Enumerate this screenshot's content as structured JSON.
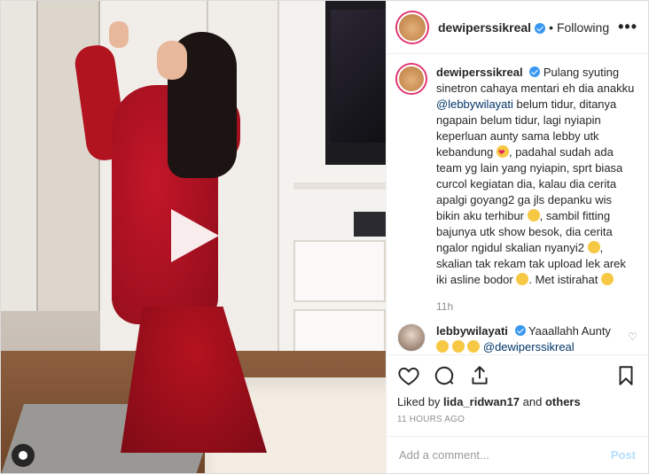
{
  "header": {
    "username": "dewiperssikreal",
    "separator": "•",
    "follow_status": "Following",
    "more_label": "•••"
  },
  "caption": {
    "username": "dewiperssikreal",
    "text_1": "Pulang syuting sinetron cahaya mentari eh dia anakku",
    "mention": "@lebbywilayati",
    "text_2": "belum tidur, ditanya ngapain belum tidur, lagi nyiapin keperluan aunty sama lebby utk kebandung",
    "text_3": ", padahal sudah ada team yg lain yang nyiapin, sprt biasa curcol kegiatan dia, kalau dia cerita apalgi goyang2 ga jls depanku wis bikin aku terhibur",
    "text_4": ", sambil fitting bajunya utk show besok, dia cerita ngalor ngidul skalian nyanyi2",
    "text_5": ", skalian tak rekam tak upload lek arek iki asline bodor",
    "text_6": ". Met istirahat",
    "time": "11h"
  },
  "reply": {
    "username": "lebbywilayati",
    "text": "Yaaallahh Aunty",
    "mention": "@dewiperssikreal"
  },
  "likes": {
    "prefix": "Liked by",
    "user": "lida_ridwan17",
    "conj": "and",
    "others": "others"
  },
  "timestamp": "11 HOURS AGO",
  "comment_box": {
    "placeholder": "Add a comment...",
    "post_label": "Post"
  },
  "colors": {
    "verified": "#3897f0",
    "post_disabled": "#b2dffc",
    "story_ring": "#e1306c"
  },
  "icons": [
    "play-icon",
    "user-tag-icon",
    "heart-icon",
    "comment-icon",
    "share-icon",
    "bookmark-icon",
    "more-options-icon",
    "verified-icon"
  ]
}
